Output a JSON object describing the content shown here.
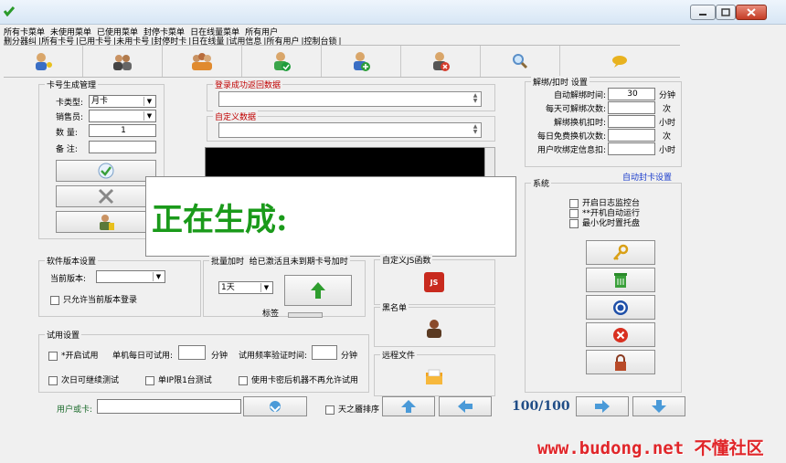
{
  "menu": [
    "所有卡菜单",
    "未使用菜单",
    "已使用菜单",
    "封停卡菜单",
    "日在线量菜单",
    "所有用户"
  ],
  "tabs": [
    "删分器纠",
    "所有卡号",
    "已用卡号",
    "未用卡号",
    "封停时卡",
    "日在线量",
    "试用信息",
    "所有用户",
    "控制台锁"
  ],
  "card_gen": {
    "title": "卡号生成管理",
    "type_label": "卡类型:",
    "type_value": "月卡",
    "seller_label": "销售员:",
    "qty_label": "数 量:",
    "qty_value": "1",
    "note_label": "备 注:"
  },
  "login_return": {
    "title": "登录成功返回数据"
  },
  "custom_data": {
    "title": "自定义数据"
  },
  "overlay": {
    "text": "正在生成:"
  },
  "unbind": {
    "title": "解绑/扣时 设置",
    "rows": [
      {
        "label": "自动解绑时间:",
        "value": "30",
        "unit": "分钟"
      },
      {
        "label": "每天可解绑次数:",
        "value": "",
        "unit": "次"
      },
      {
        "label": "解绑换机扣时:",
        "value": "",
        "unit": "小时"
      },
      {
        "label": "每日免费换机次数:",
        "value": "",
        "unit": "次"
      },
      {
        "label": "用户吹绑定信息扣:",
        "value": "",
        "unit": "小时"
      }
    ],
    "auto_seal_link": "自动封卡设置"
  },
  "system": {
    "title": "系统",
    "options": [
      "开启日志监控台",
      "**开机自动运行",
      "最小化时置托盘"
    ]
  },
  "version": {
    "title": "软件版本设置",
    "current_label": "当前版本:",
    "only_current_label": "只允许当前版本登录"
  },
  "batch": {
    "title": "批量加时",
    "desc": "给已激活且未到期卡号加时",
    "select_value": "1天",
    "tag_label": "标签"
  },
  "custom_js": {
    "title": "自定义JS函数",
    "icon_text": "JS"
  },
  "blacklist": {
    "title": "黑名单"
  },
  "remote": {
    "title": "远程文件"
  },
  "trial": {
    "title": "试用设置",
    "enable_label": "*开启试用",
    "per_machine_label": "单机每日可试用:",
    "minutes_unit_1": "分钟",
    "freq_label": "试用频率验证时间:",
    "minutes_unit_2": "分钟",
    "next_day_label": "次日可继续测试",
    "single_ip_label": "单IP限1台测试",
    "no_trial_after_label": "使用卡密后机器不再允许试用"
  },
  "bottom": {
    "user_label": "用户或卡:",
    "sort_label": "天之靥排序",
    "page_counter": "100/100"
  },
  "watermark": "www.budong.net 不懂社区"
}
